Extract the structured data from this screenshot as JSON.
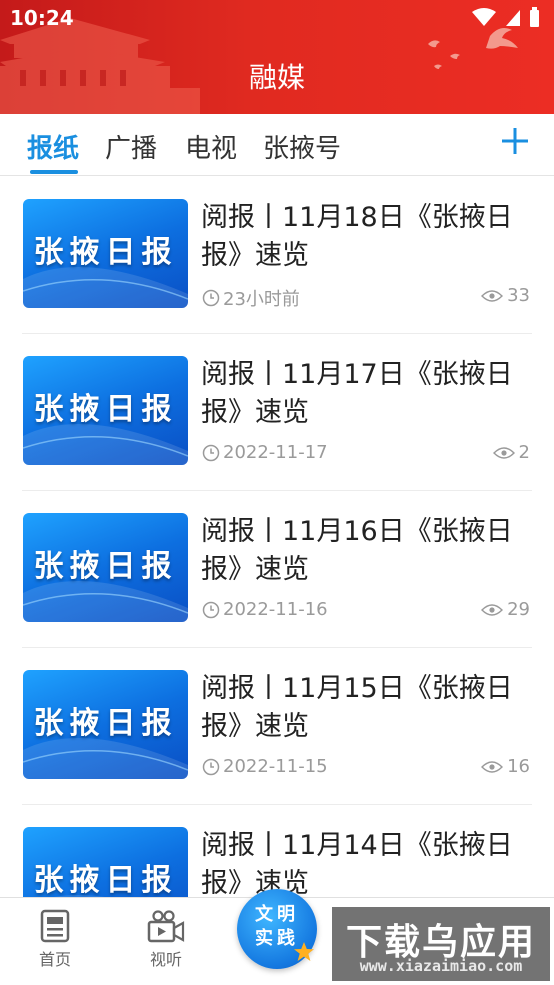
{
  "status_bar": {
    "time": "10:24"
  },
  "header": {
    "title": "融媒"
  },
  "tabs": [
    {
      "label": "报纸",
      "active": true
    },
    {
      "label": "广播",
      "active": false
    },
    {
      "label": "电视",
      "active": false
    },
    {
      "label": "张掖号",
      "active": false
    }
  ],
  "thumbnail_text": "张掖日报",
  "articles": [
    {
      "title": "阅报丨11月18日《张掖日报》速览",
      "time": "23小时前",
      "views": "33"
    },
    {
      "title": "阅报丨11月17日《张掖日报》速览",
      "time": "2022-11-17",
      "views": "2"
    },
    {
      "title": "阅报丨11月16日《张掖日报》速览",
      "time": "2022-11-16",
      "views": "29"
    },
    {
      "title": "阅报丨11月15日《张掖日报》速览",
      "time": "2022-11-15",
      "views": "16"
    },
    {
      "title": "阅报丨11月14日《张掖日报》速览",
      "time": "",
      "views": ""
    }
  ],
  "bottom_nav": {
    "home": "首页",
    "video": "视听",
    "center": "文明实践",
    "center_line1": "文明",
    "center_line2": "实践"
  },
  "watermark": {
    "main": "下载乌应用",
    "sub": "www.xiazaimiao.com"
  },
  "colors": {
    "accent": "#1a8fe0",
    "header_red": "#e02a20",
    "thumb_blue": "#0d6fe0"
  }
}
